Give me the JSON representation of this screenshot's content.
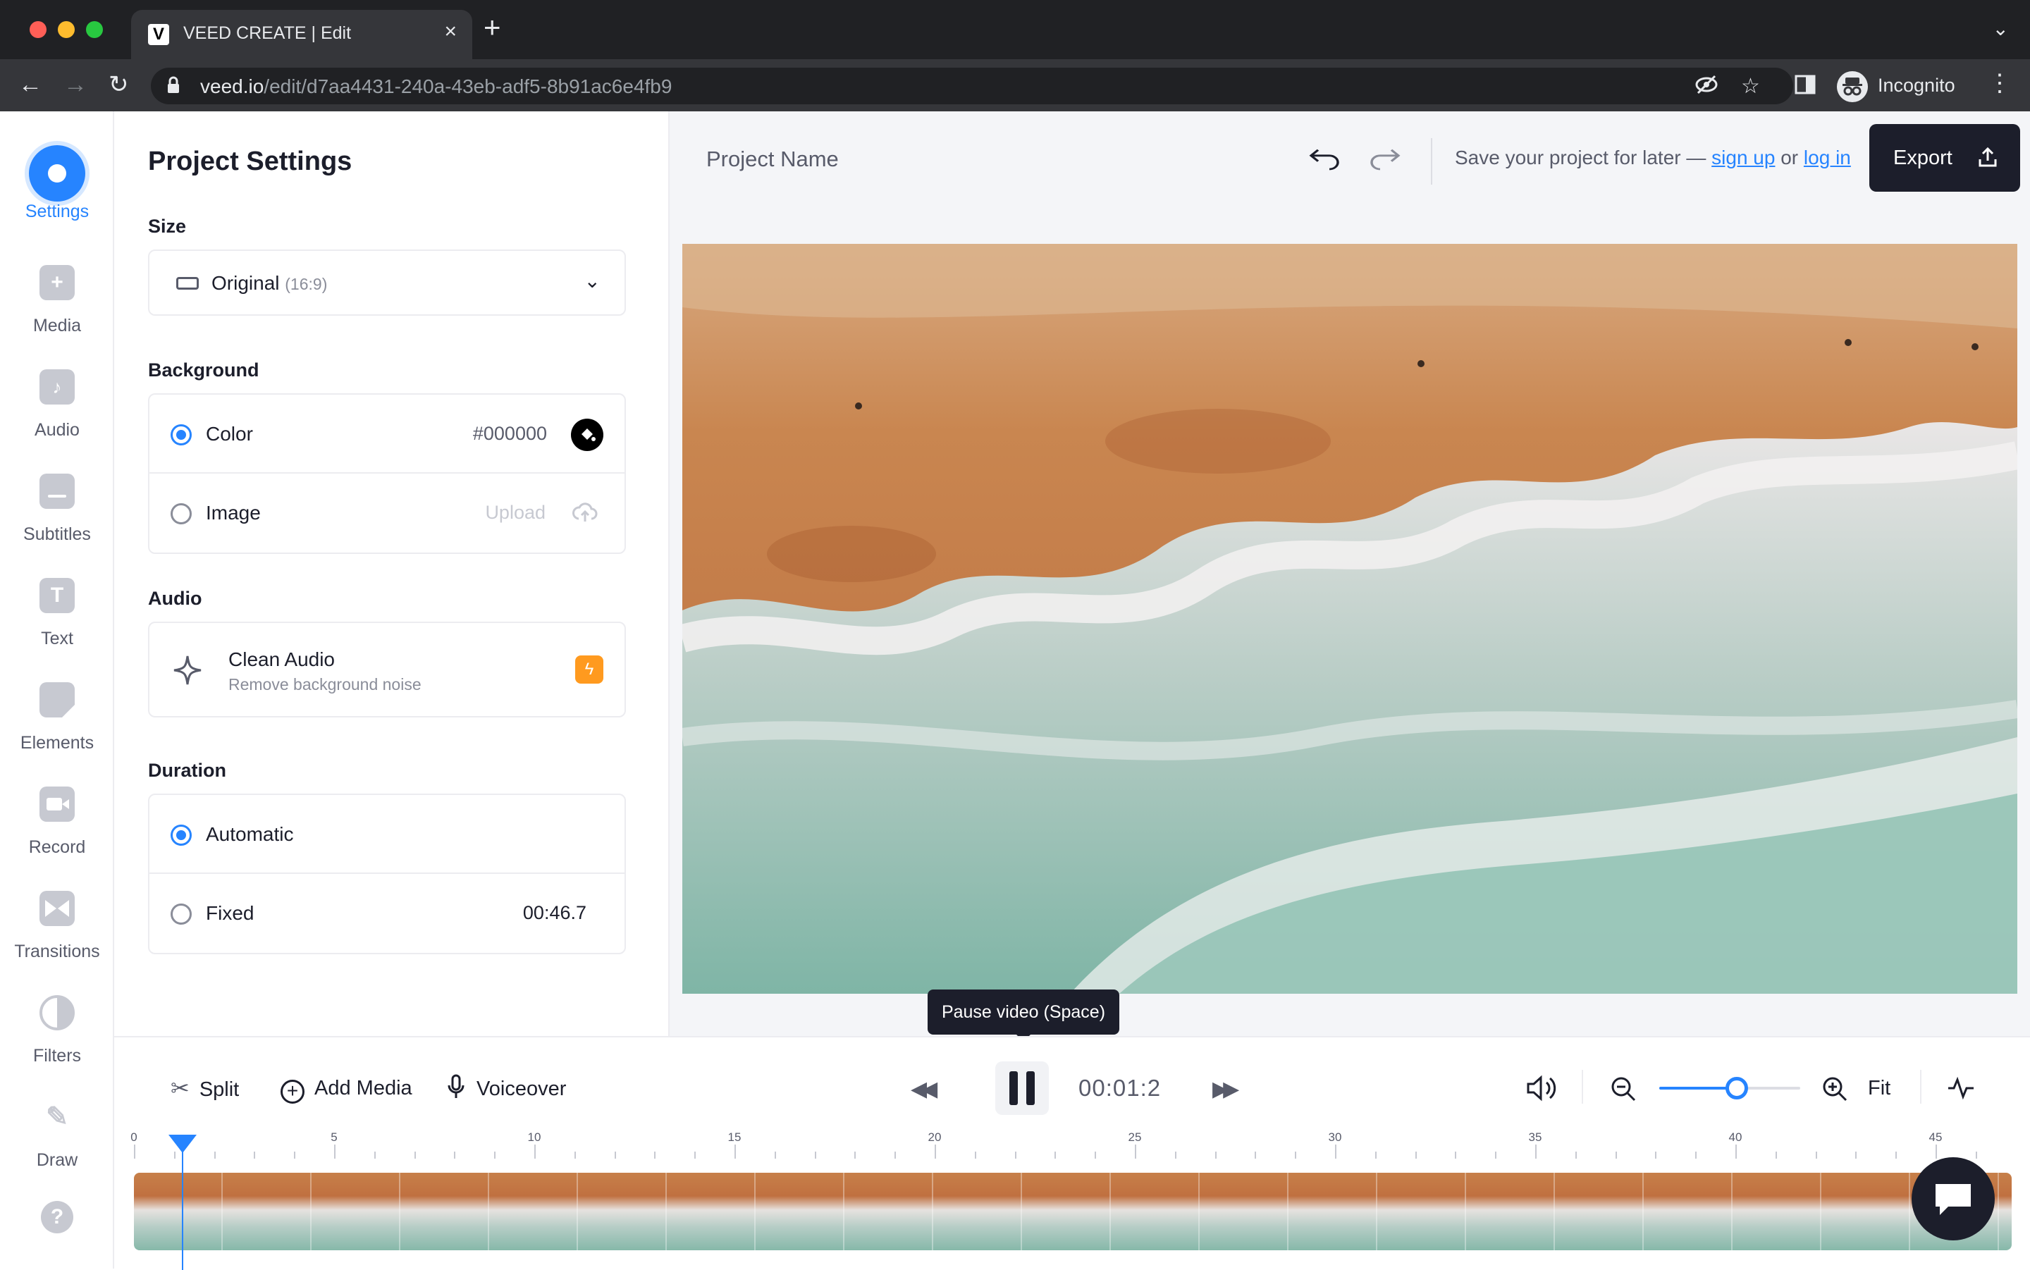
{
  "browser": {
    "tab_title": "VEED CREATE | Edit",
    "tab_favicon": "V",
    "url_host": "veed.io",
    "url_path": "/edit/d7aa4431-240a-43eb-adf5-8b91ac6e4fb9",
    "profile_label": "Incognito"
  },
  "rail": {
    "items": [
      {
        "label": "Settings",
        "icon": "settings-icon",
        "active": true
      },
      {
        "label": "Media",
        "icon": "plus-icon"
      },
      {
        "label": "Audio",
        "icon": "music-note-icon"
      },
      {
        "label": "Subtitles",
        "icon": "subtitles-icon"
      },
      {
        "label": "Text",
        "icon": "text-icon"
      },
      {
        "label": "Elements",
        "icon": "elements-icon"
      },
      {
        "label": "Record",
        "icon": "camera-icon"
      },
      {
        "label": "Transitions",
        "icon": "transitions-icon"
      },
      {
        "label": "Filters",
        "icon": "filters-icon"
      },
      {
        "label": "Draw",
        "icon": "pencil-icon"
      }
    ],
    "help_icon": "help-icon"
  },
  "panel": {
    "title": "Project Settings",
    "size": {
      "label": "Size",
      "value": "Original",
      "ratio": "(16:9)"
    },
    "background": {
      "label": "Background",
      "color_label": "Color",
      "color_value": "#000000",
      "image_label": "Image",
      "upload_label": "Upload"
    },
    "audio": {
      "label": "Audio",
      "title": "Clean Audio",
      "subtitle": "Remove background noise"
    },
    "duration": {
      "label": "Duration",
      "automatic_label": "Automatic",
      "fixed_label": "Fixed",
      "fixed_value": "00:46.7"
    }
  },
  "topbar": {
    "project_name": "Project Name",
    "save_text": "Save your project for later —",
    "sign_up": "sign up",
    "or": "or",
    "log_in": "log in",
    "export": "Export"
  },
  "player": {
    "tooltip": "Pause video (Space)",
    "timecode": "00:01:2"
  },
  "timeline": {
    "split": "Split",
    "add_media": "Add Media",
    "voiceover": "Voiceover",
    "fit": "Fit",
    "zoom_level": 0.55,
    "ruler_labels": [
      "0",
      "5",
      "10",
      "15",
      "20",
      "25",
      "30",
      "35",
      "40",
      "45"
    ],
    "playhead_seconds": 1.2
  },
  "colors": {
    "accent": "#2684ff",
    "dark": "#1c1e2b",
    "bolt": "#ff9a1f"
  }
}
